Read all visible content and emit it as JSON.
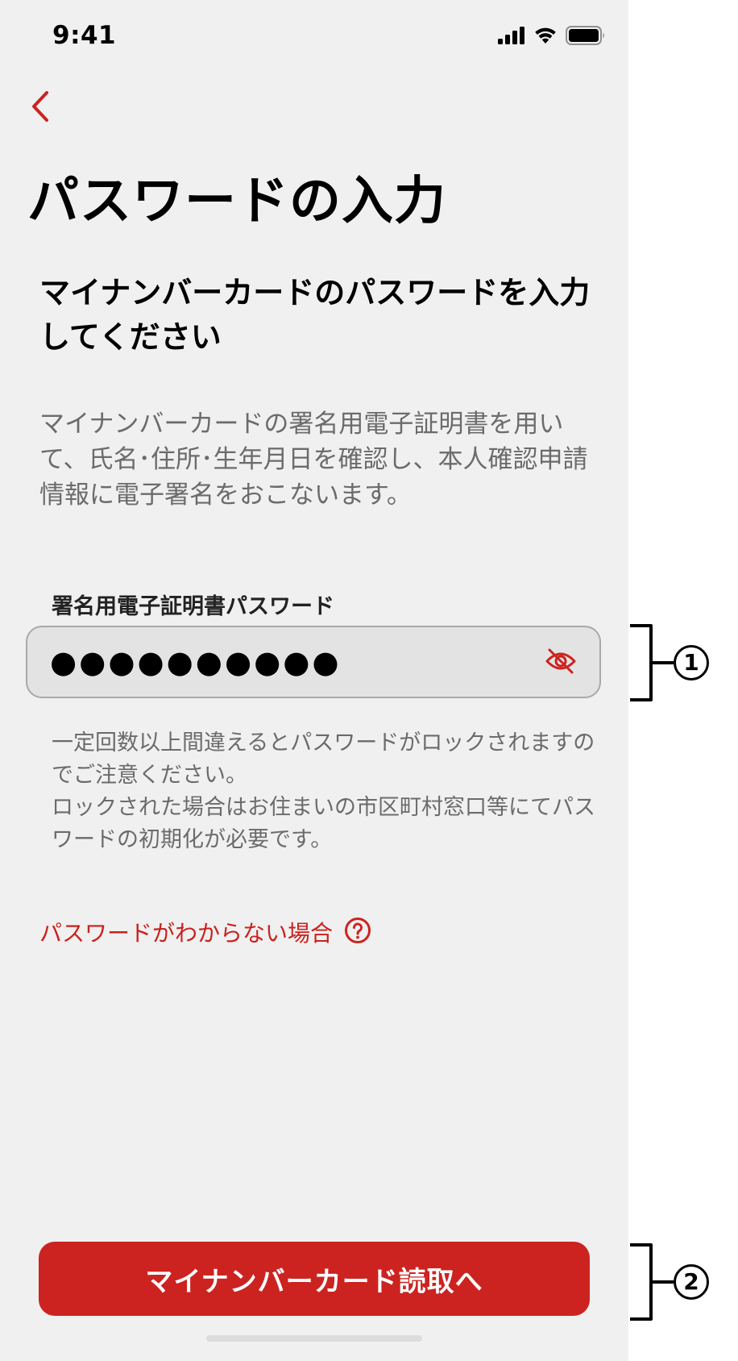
{
  "status_bar": {
    "time": "9:41",
    "icons": [
      "cellular-signal-icon",
      "wifi-icon",
      "battery-icon"
    ]
  },
  "navigation": {
    "back_icon": "chevron-left-icon"
  },
  "page": {
    "title": "パスワードの入力",
    "heading": "マイナンバーカードのパスワードを入力してください",
    "description": "マイナンバーカードの署名用電子証明書を用いて、氏名･住所･生年月日を確認し、本人確認申請情報に電子署名をおこないます。"
  },
  "password_field": {
    "label": "署名用電子証明書パスワード",
    "masked_value": "●●●●●●●●●●",
    "toggle_icon": "eye-off-icon"
  },
  "warning": {
    "line1": "一定回数以上間違えるとパスワードがロックされますのでご注意ください。",
    "line2": "ロックされた場合はお住まいの市区町村窓口等にてパスワードの初期化が必要です。"
  },
  "help_link": {
    "label": "パスワードがわからない場合",
    "icon": "question-circle-icon"
  },
  "primary_button": {
    "label": "マイナンバーカード読取へ"
  },
  "annotations": [
    {
      "number": "1"
    },
    {
      "number": "2"
    }
  ],
  "colors": {
    "accent": "#cc2320",
    "background": "#f0f0f0",
    "field_background": "#e3e3e3",
    "text_secondary": "#6b6b6b"
  }
}
